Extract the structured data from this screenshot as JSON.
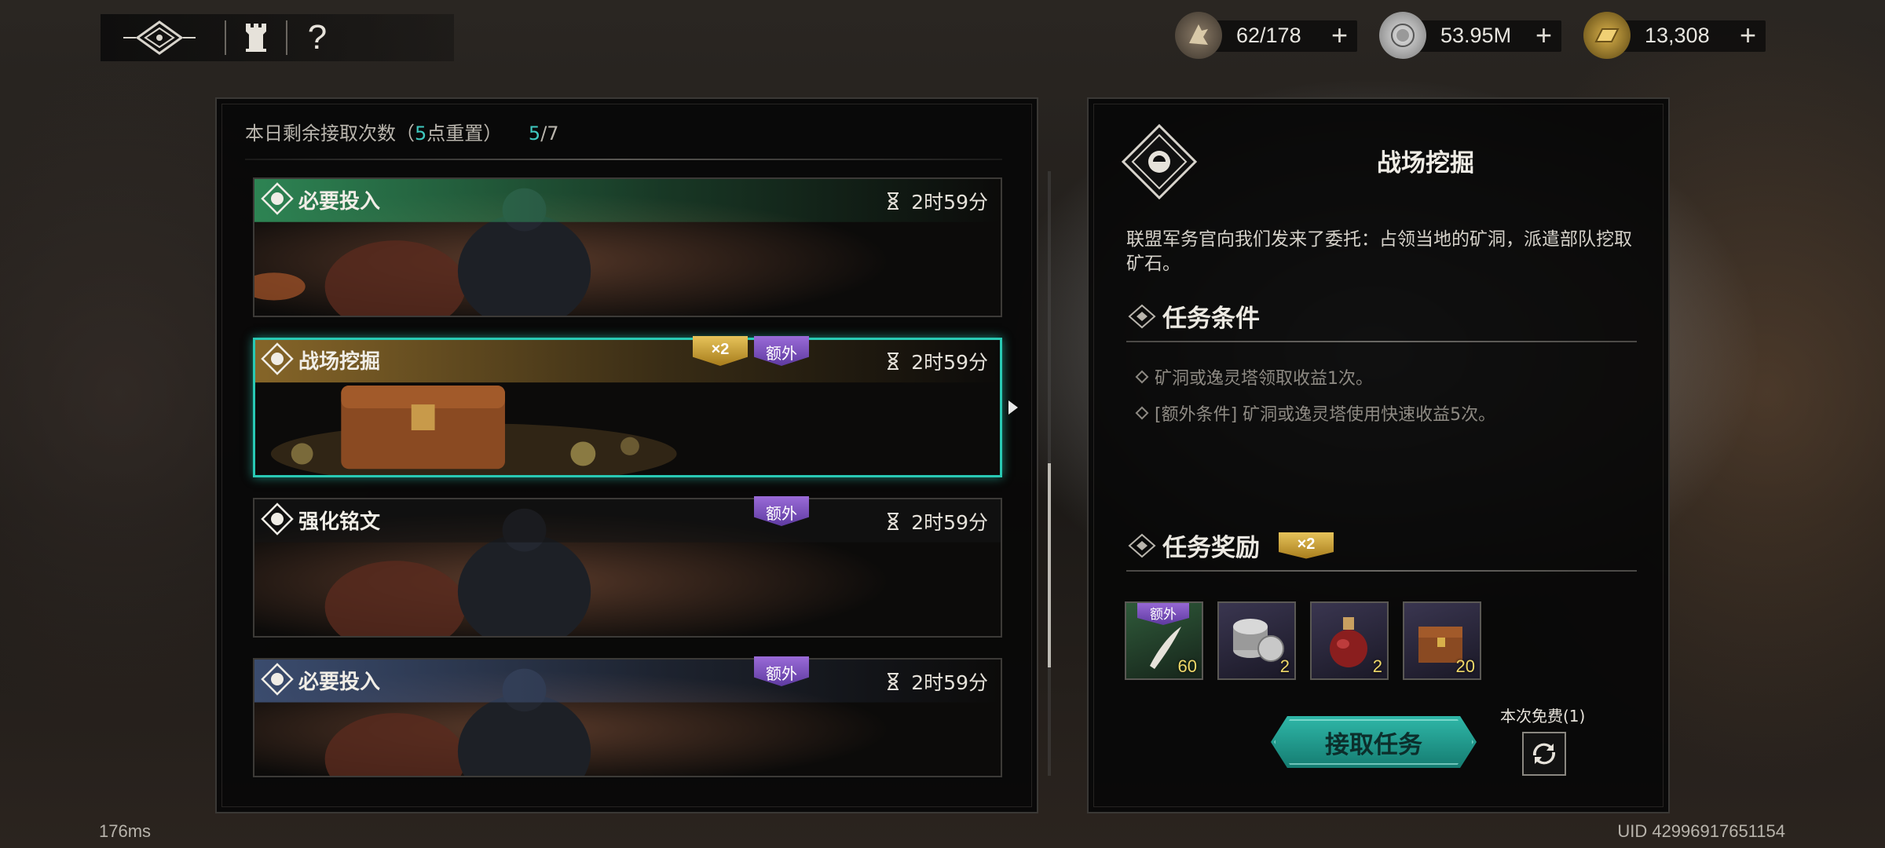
{
  "topbar": {
    "logo_icon": "guild-emblem-icon",
    "tower_icon": "tower-icon",
    "help_label": "?"
  },
  "resources": [
    {
      "icon": "stamina-icon",
      "value": "62/178",
      "plus": "+"
    },
    {
      "icon": "silver-coin-icon",
      "value": "53.95M",
      "plus": "+"
    },
    {
      "icon": "gold-ingot-icon",
      "value": "13,308",
      "plus": "+"
    }
  ],
  "left_panel": {
    "daily_prefix": "本日剩余接取次数（",
    "daily_reset_hour": "5",
    "daily_reset_suffix": "点重置）",
    "daily_used": "5",
    "daily_total": "/7",
    "tasks": [
      {
        "title": "必要投入",
        "timer": "2时59分",
        "badges": [],
        "accent": "#2f8a57",
        "selected": false
      },
      {
        "title": "战场挖掘",
        "timer": "2时59分",
        "badges": [
          "×2",
          "额外"
        ],
        "accent": "#8c6a2a",
        "selected": true
      },
      {
        "title": "强化铭文",
        "timer": "2时59分",
        "badges": [
          "额外"
        ],
        "accent": "#1a1918",
        "selected": false
      },
      {
        "title": "必要投入",
        "timer": "2时59分",
        "badges": [
          "额外"
        ],
        "accent": "#3d4f73",
        "selected": false
      }
    ]
  },
  "detail": {
    "title": "战场挖掘",
    "description": "联盟军务官向我们发来了委托：占领当地的矿洞，派遣部队挖取矿石。",
    "conditions_heading": "任务条件",
    "conditions": [
      "矿洞或逸灵塔领取收益1次。",
      "[额外条件] 矿洞或逸灵塔使用快速收益5次。"
    ],
    "rewards_heading": "任务奖励",
    "rewards_multiplier": "×2",
    "rewards": [
      {
        "icon": "feather-icon",
        "count": "60",
        "extra": "额外"
      },
      {
        "icon": "silver-coins-icon",
        "count": "2",
        "extra": ""
      },
      {
        "icon": "potion-icon",
        "count": "2",
        "extra": ""
      },
      {
        "icon": "treasure-chest-icon",
        "count": "20",
        "extra": ""
      }
    ],
    "accept_label": "接取任务",
    "free_label": "本次免费(1)",
    "refresh_icon": "refresh-icon"
  },
  "footer": {
    "latency": "176ms",
    "uid": "UID 42996917651154"
  },
  "colors": {
    "accent_teal": "#29c9b4",
    "badge_gold": "#d4a93a",
    "badge_purple": "#7c50c0"
  }
}
